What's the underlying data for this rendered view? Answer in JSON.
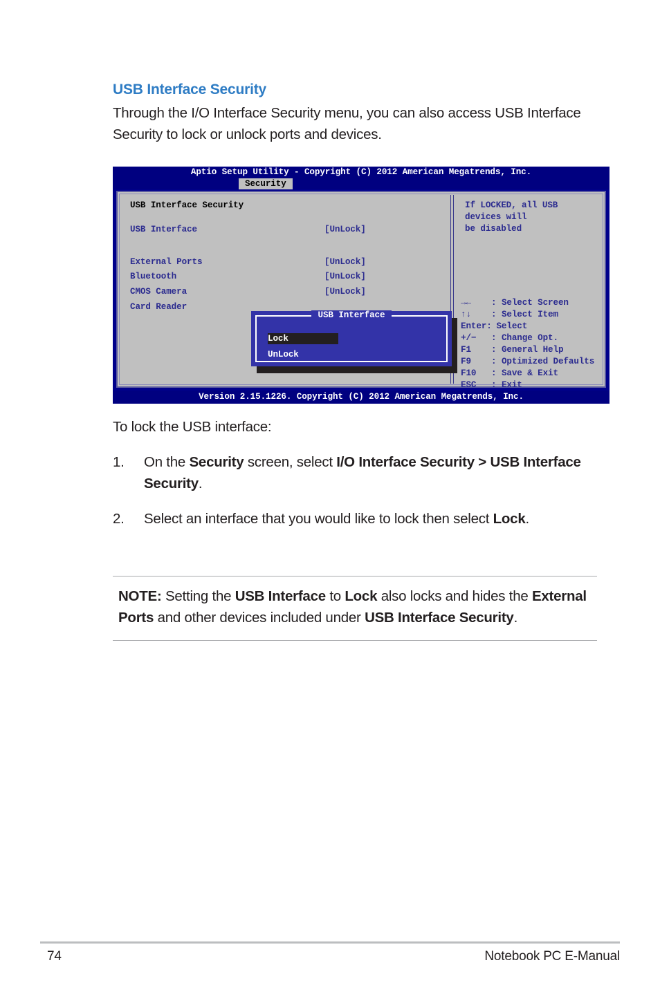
{
  "section": {
    "title": "USB Interface Security",
    "intro": "Through the I/O Interface Security menu, you can also access USB Interface Security to lock or unlock ports and devices."
  },
  "bios": {
    "titlebar": "Aptio Setup Utility - Copyright (C) 2012 American Megatrends, Inc.",
    "active_tab": "Security",
    "screen_heading": "USB Interface Security",
    "rows": [
      {
        "label": "USB Interface",
        "value": "[UnLock]"
      },
      {
        "label": "External Ports",
        "value": "[UnLock]"
      },
      {
        "label": "Bluetooth",
        "value": "[UnLock]"
      },
      {
        "label": "CMOS Camera",
        "value": "[UnLock]"
      },
      {
        "label": "Card Reader",
        "value": ""
      }
    ],
    "help_lines": [
      "If LOCKED, all USB",
      "devices will",
      "be disabled"
    ],
    "keys": [
      {
        "key": "→←",
        "sep": ":",
        "action": "Select Screen"
      },
      {
        "key": "↑↓",
        "sep": ":",
        "action": "Select Item"
      },
      {
        "key": "Enter:",
        "sep": "",
        "action": "Select"
      },
      {
        "key": "+/−",
        "sep": ":",
        "action": "Change Opt."
      },
      {
        "key": "F1",
        "sep": ":",
        "action": "General Help"
      },
      {
        "key": "F9",
        "sep": ":",
        "action": "Optimized Defaults"
      },
      {
        "key": "F10",
        "sep": ":",
        "action": "Save & Exit"
      },
      {
        "key": "ESC",
        "sep": ":",
        "action": "Exit"
      }
    ],
    "popup": {
      "title": "USB Interface",
      "options": [
        "Lock",
        "UnLock"
      ],
      "selected": "Lock"
    },
    "footer": "Version 2.15.1226. Copyright (C) 2012 American Megatrends, Inc.",
    "colors": {
      "titlebar_bg": "#000080",
      "panel_bg": "#c0c0c0",
      "text_blue": "#2b2b8f",
      "popup_bg": "#3333a8",
      "highlight_bg": "#231f20"
    }
  },
  "procedure": {
    "lead": "To lock the USB interface:",
    "steps": [
      {
        "number": "1.",
        "parts": [
          {
            "text": "On the ",
            "bold": false
          },
          {
            "text": "Security",
            "bold": true
          },
          {
            "text": " screen, select ",
            "bold": false
          },
          {
            "text": "I/O Interface Security > USB Interface Security",
            "bold": true
          },
          {
            "text": ".",
            "bold": false
          }
        ]
      },
      {
        "number": "2.",
        "parts": [
          {
            "text": "Select an interface that you would like to lock then select ",
            "bold": false
          },
          {
            "text": "Lock",
            "bold": true
          },
          {
            "text": ".",
            "bold": false
          }
        ]
      }
    ]
  },
  "note": {
    "parts": [
      {
        "text": "NOTE:",
        "bold": true
      },
      {
        "text": " Setting the ",
        "bold": false
      },
      {
        "text": "USB Interface",
        "bold": true
      },
      {
        "text": " to ",
        "bold": false
      },
      {
        "text": "Lock",
        "bold": true
      },
      {
        "text": " also locks and hides the ",
        "bold": false
      },
      {
        "text": "External Ports",
        "bold": true
      },
      {
        "text": " and other devices included under ",
        "bold": false
      },
      {
        "text": "USB Interface Security",
        "bold": true
      },
      {
        "text": ".",
        "bold": false
      }
    ]
  },
  "page_footer": {
    "page_number": "74",
    "manual_title": "Notebook PC E-Manual"
  },
  "theme": {
    "heading_blue": "#2e7cc4",
    "body_text": "#231f20",
    "rule_gray": "#a7a9ac"
  }
}
